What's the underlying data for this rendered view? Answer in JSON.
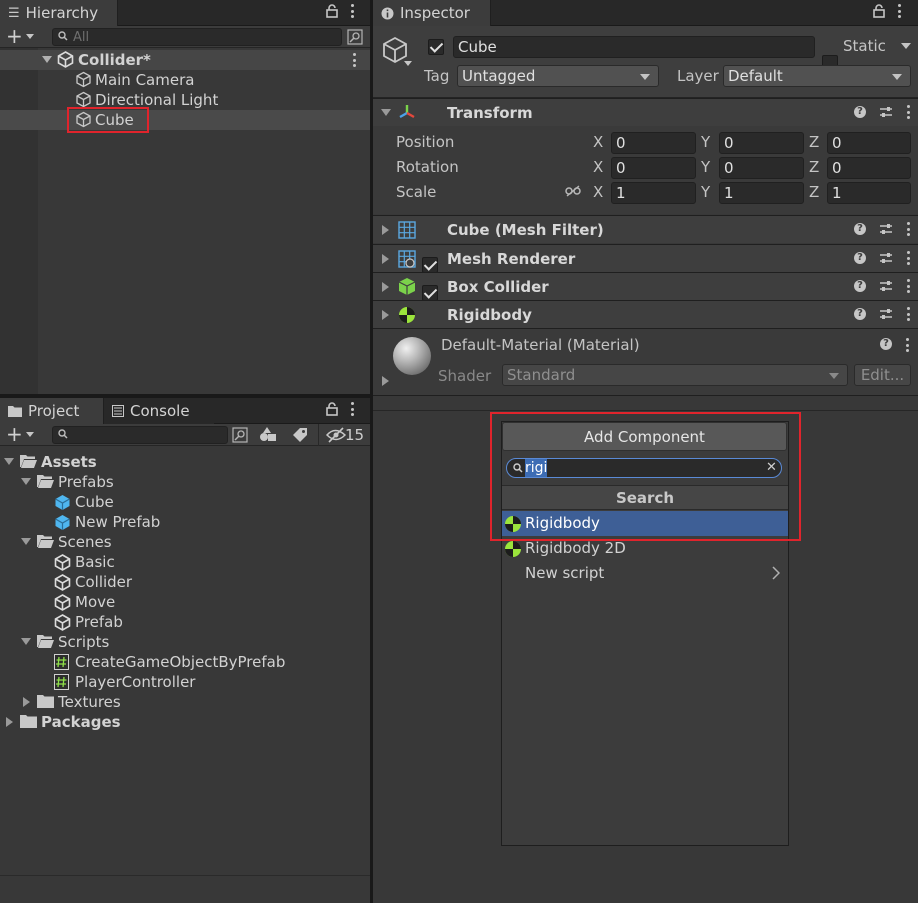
{
  "hierarchy": {
    "tab": "Hierarchy",
    "search_placeholder": "All",
    "scene": "Collider*",
    "items": [
      "Main Camera",
      "Directional Light",
      "Cube"
    ]
  },
  "project": {
    "tabs": [
      "Project",
      "Console"
    ],
    "hidden_count": "15",
    "tree": [
      {
        "label": "Assets",
        "depth": 0,
        "type": "folder-open",
        "bold": true
      },
      {
        "label": "Prefabs",
        "depth": 1,
        "type": "folder-open",
        "bold": false
      },
      {
        "label": "Cube",
        "depth": 2,
        "type": "prefab",
        "bold": false
      },
      {
        "label": "New Prefab",
        "depth": 2,
        "type": "prefab",
        "bold": false
      },
      {
        "label": "Scenes",
        "depth": 1,
        "type": "folder-open",
        "bold": false
      },
      {
        "label": "Basic",
        "depth": 2,
        "type": "scene",
        "bold": false
      },
      {
        "label": "Collider",
        "depth": 2,
        "type": "scene",
        "bold": false
      },
      {
        "label": "Move",
        "depth": 2,
        "type": "scene",
        "bold": false
      },
      {
        "label": "Prefab",
        "depth": 2,
        "type": "scene",
        "bold": false
      },
      {
        "label": "Scripts",
        "depth": 1,
        "type": "folder-open",
        "bold": false
      },
      {
        "label": "CreateGameObjectByPrefab",
        "depth": 2,
        "type": "script",
        "bold": false
      },
      {
        "label": "PlayerController",
        "depth": 2,
        "type": "script",
        "bold": false
      },
      {
        "label": "Textures",
        "depth": 1,
        "type": "folder-closed",
        "bold": false
      },
      {
        "label": "Packages",
        "depth": 0,
        "type": "folder-closed",
        "bold": true
      }
    ]
  },
  "inspector": {
    "tab": "Inspector",
    "object_name": "Cube",
    "static_label": "Static",
    "tag_label": "Tag",
    "tag_value": "Untagged",
    "layer_label": "Layer",
    "layer_value": "Default",
    "transform": {
      "title": "Transform",
      "rows": [
        {
          "label": "Position",
          "x": "0",
          "y": "0",
          "z": "0"
        },
        {
          "label": "Rotation",
          "x": "0",
          "y": "0",
          "z": "0"
        },
        {
          "label": "Scale",
          "x": "1",
          "y": "1",
          "z": "1"
        }
      ],
      "axis_labels": [
        "X",
        "Y",
        "Z"
      ]
    },
    "components": [
      "Cube (Mesh Filter)",
      "Mesh Renderer",
      "Box Collider",
      "Rigidbody"
    ],
    "material": {
      "name": "Default-Material (Material)",
      "shader_label": "Shader",
      "shader_value": "Standard",
      "edit_label": "Edit..."
    }
  },
  "add_component": {
    "button": "Add Component",
    "search_value": "rigi",
    "section": "Search",
    "results": [
      "Rigidbody",
      "Rigidbody 2D",
      "New script"
    ]
  },
  "colors": {
    "highlight_red": "#e0242c",
    "selection_blue": "#3e5f96",
    "rigidbody_green": "#9be43c"
  }
}
